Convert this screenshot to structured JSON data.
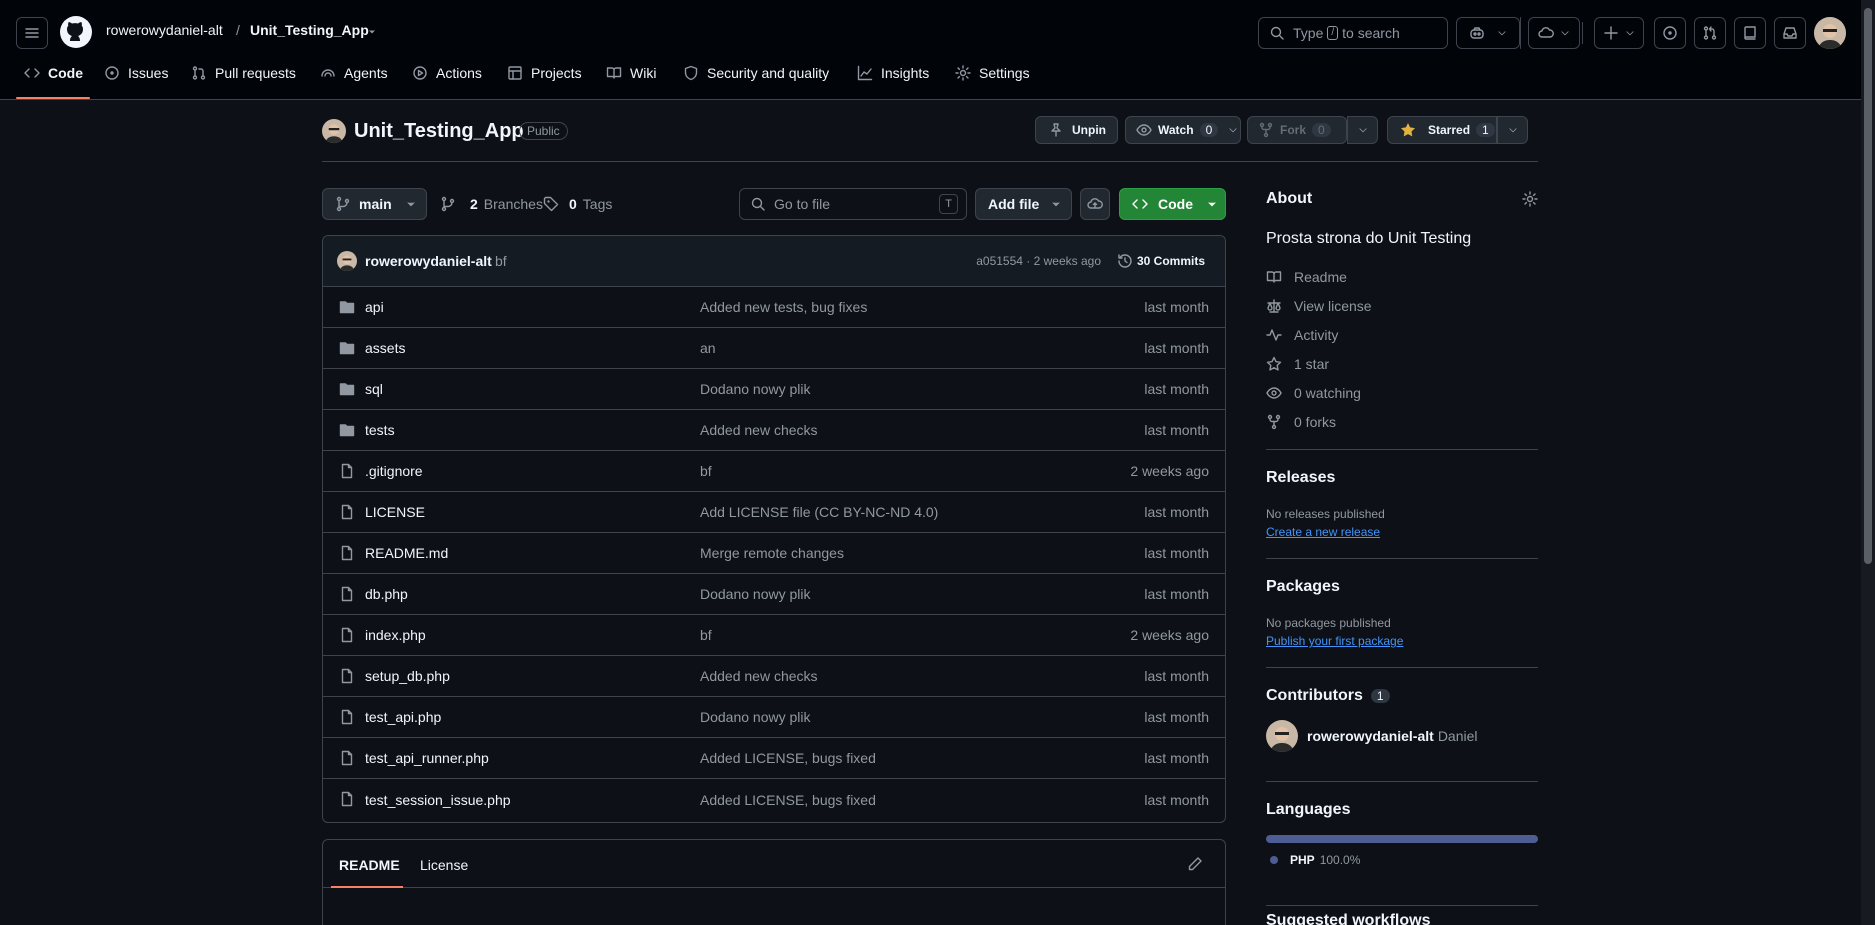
{
  "header": {
    "owner": "rowerowydaniel-alt",
    "separator": "/",
    "repo": "Unit_Testing_App",
    "search_text": "Type",
    "search_key": "/",
    "search_suffix": "to search"
  },
  "nav": {
    "code": "Code",
    "issues": "Issues",
    "pulls": "Pull requests",
    "agents": "Agents",
    "actions": "Actions",
    "projects": "Projects",
    "wiki": "Wiki",
    "security": "Security and quality",
    "insights": "Insights",
    "settings": "Settings"
  },
  "repo": {
    "title": "Unit_Testing_App",
    "visibility": "Public",
    "unpin": "Unpin",
    "watch": "Watch",
    "watch_count": "0",
    "fork": "Fork",
    "fork_count": "0",
    "starred": "Starred",
    "star_count": "1"
  },
  "toolbar": {
    "branch": "main",
    "branches_count": "2",
    "branches_label": "Branches",
    "tags_count": "0",
    "tags_label": "Tags",
    "goto_placeholder": "Go to file",
    "goto_key": "T",
    "add_file": "Add file",
    "code": "Code"
  },
  "commit": {
    "author": "rowerowydaniel-alt",
    "message": "bf",
    "hash_time": "a051554 · 2 weeks ago",
    "commits": "30 Commits"
  },
  "files": [
    {
      "type": "dir",
      "name": "api",
      "message": "Added new tests, bug fixes",
      "date": "last month"
    },
    {
      "type": "dir",
      "name": "assets",
      "message": "an",
      "date": "last month"
    },
    {
      "type": "dir",
      "name": "sql",
      "message": "Dodano nowy plik",
      "date": "last month"
    },
    {
      "type": "dir",
      "name": "tests",
      "message": "Added new checks",
      "date": "last month"
    },
    {
      "type": "file",
      "name": ".gitignore",
      "message": "bf",
      "date": "2 weeks ago"
    },
    {
      "type": "file",
      "name": "LICENSE",
      "message": "Add LICENSE file (CC BY-NC-ND 4.0)",
      "date": "last month"
    },
    {
      "type": "file",
      "name": "README.md",
      "message": "Merge remote changes",
      "date": "last month"
    },
    {
      "type": "file",
      "name": "db.php",
      "message": "Dodano nowy plik",
      "date": "last month"
    },
    {
      "type": "file",
      "name": "index.php",
      "message": "bf",
      "date": "2 weeks ago"
    },
    {
      "type": "file",
      "name": "setup_db.php",
      "message": "Added new checks",
      "date": "last month"
    },
    {
      "type": "file",
      "name": "test_api.php",
      "message": "Dodano nowy plik",
      "date": "last month"
    },
    {
      "type": "file",
      "name": "test_api_runner.php",
      "message": "Added LICENSE, bugs fixed",
      "date": "last month"
    },
    {
      "type": "file",
      "name": "test_session_issue.php",
      "message": "Added LICENSE, bugs fixed",
      "date": "last month"
    }
  ],
  "readme": {
    "tab_readme": "README",
    "tab_license": "License"
  },
  "about": {
    "heading": "About",
    "description": "Prosta strona do Unit Testing",
    "readme": "Readme",
    "license": "View license",
    "activity": "Activity",
    "stars": "1 star",
    "watching": "0 watching",
    "forks": "0 forks"
  },
  "releases": {
    "heading": "Releases",
    "none": "No releases published",
    "create": "Create a new release"
  },
  "packages": {
    "heading": "Packages",
    "none": "No packages published",
    "publish": "Publish your first package"
  },
  "contributors": {
    "heading": "Contributors",
    "count": "1",
    "user": "rowerowydaniel-alt",
    "name": "Daniel"
  },
  "languages": {
    "heading": "Languages",
    "lang": "PHP",
    "percent": "100.0%",
    "fraction": 1.0,
    "color": "#4f5d95"
  },
  "suggested": {
    "heading": "Suggested workflows"
  }
}
